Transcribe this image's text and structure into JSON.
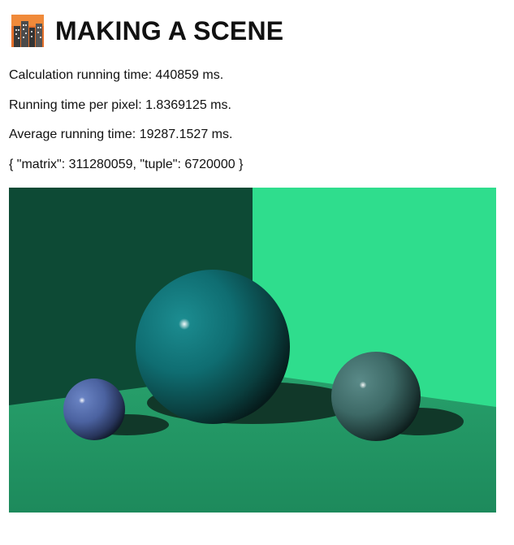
{
  "header": {
    "title": "MAKING A SCENE",
    "logo_icon": "city-buildings-icon"
  },
  "stats": {
    "calculation_time": "Calculation running time: 440859 ms.",
    "time_per_pixel": "Running time per pixel: 1.8369125 ms.",
    "average_time": "Average running time: 19287.1527 ms.",
    "counts": "{ \"matrix\": 311280059, \"tuple\": 6720000 }"
  },
  "scene": {
    "description_icon": "raytraced-scene-image",
    "colors": {
      "left_wall": "#0d4a35",
      "right_wall": "#2fdd8d",
      "floor": "#1f8a5f",
      "middle_sphere": "#0f6e72",
      "left_sphere": "#4f6aa8",
      "right_sphere": "#3f6f6c"
    }
  }
}
